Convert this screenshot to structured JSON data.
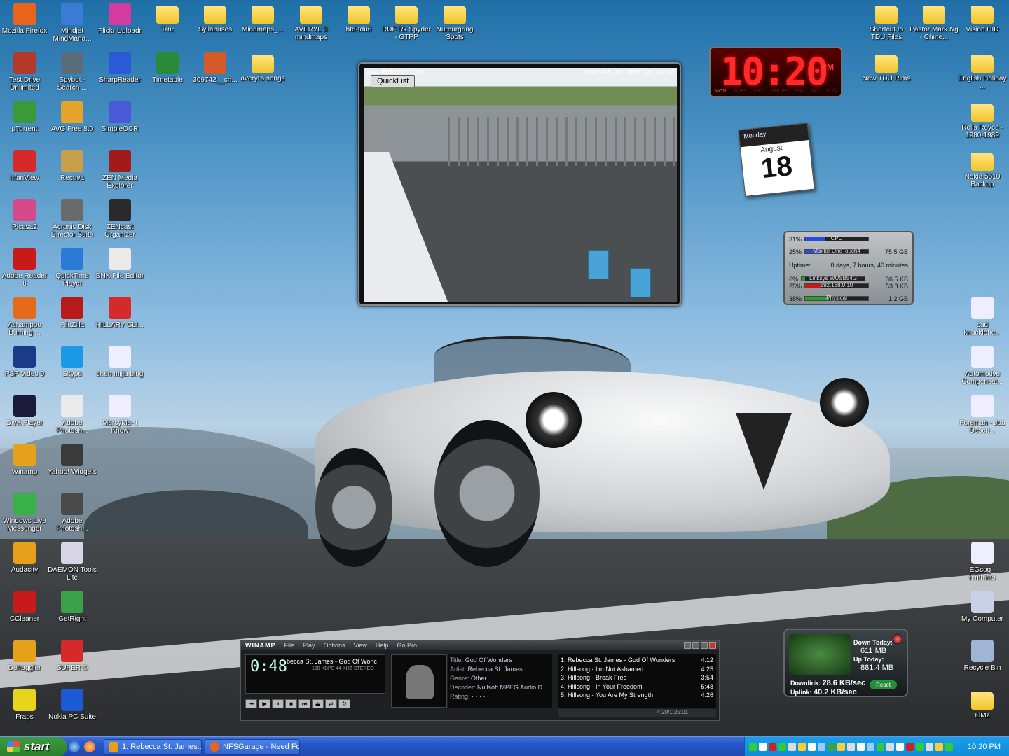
{
  "desktop": {
    "icons": [
      {
        "id": "firefox",
        "label": "Mozilla Firefox",
        "kind": "app",
        "color": "#e8641b"
      },
      {
        "id": "mindjet",
        "label": "Mindjet MindMana...",
        "kind": "app",
        "color": "#3a7bd5"
      },
      {
        "id": "flickr",
        "label": "Flickr Uploadr",
        "kind": "app",
        "color": "#d43aa0"
      },
      {
        "id": "trnr",
        "label": "Trnr",
        "kind": "folder"
      },
      {
        "id": "syllabuses",
        "label": "Syllabuses",
        "kind": "folder"
      },
      {
        "id": "mindmaps",
        "label": "Mindmaps_...",
        "kind": "folder"
      },
      {
        "id": "averyl-mindmaps",
        "label": "AVERYL'S mindmaps",
        "kind": "folder"
      },
      {
        "id": "htd-tdu6",
        "label": "htd-tdu6",
        "kind": "folder"
      },
      {
        "id": "ruf",
        "label": "RUF Rk Spyder - GTPP",
        "kind": "folder"
      },
      {
        "id": "nurburgring",
        "label": "Nurburgring Spots",
        "kind": "folder"
      },
      {
        "id": "shortcut-tdu",
        "label": "Shortcut to TDU Files",
        "kind": "folder"
      },
      {
        "id": "pastor",
        "label": "Pastor Mark Ng - Chine...",
        "kind": "folder"
      },
      {
        "id": "vision-hid",
        "label": "Vision HID",
        "kind": "folder"
      },
      {
        "id": "test-drive",
        "label": "Test Drive Unlimited",
        "kind": "app",
        "color": "#b33a2a"
      },
      {
        "id": "spybot",
        "label": "Spybot - Search ...",
        "kind": "app",
        "color": "#5a6b7a"
      },
      {
        "id": "sharpreader",
        "label": "SharpReader",
        "kind": "app",
        "color": "#2a5bd6"
      },
      {
        "id": "timetable",
        "label": "Timetable",
        "kind": "app",
        "color": "#2a8a3a"
      },
      {
        "id": "309742",
        "label": "309742__ch...",
        "kind": "app",
        "color": "#d45a2a"
      },
      {
        "id": "averyl-songs",
        "label": "averyl's songs",
        "kind": "folder"
      },
      {
        "id": "new-tdu-rims",
        "label": "New TDU Rims",
        "kind": "folder"
      },
      {
        "id": "english-holiday",
        "label": "English Holiday ...",
        "kind": "folder"
      },
      {
        "id": "utorrent",
        "label": "µTorrent",
        "kind": "app",
        "color": "#3a9a3a"
      },
      {
        "id": "avg",
        "label": "AVG Free 8.0",
        "kind": "app",
        "color": "#e6a52a"
      },
      {
        "id": "simpleocr",
        "label": "SimpleOCR",
        "kind": "app",
        "color": "#4a5ad6"
      },
      {
        "id": "rolls-royce",
        "label": "Rolls Royce - 1980-1989",
        "kind": "folder"
      },
      {
        "id": "irfanview",
        "label": "IrfanView",
        "kind": "app",
        "color": "#d62a2a"
      },
      {
        "id": "recuva",
        "label": "Recuva",
        "kind": "app",
        "color": "#c8a04a"
      },
      {
        "id": "zen-media",
        "label": "ZEN Media Explorer",
        "kind": "app",
        "color": "#a01a1a"
      },
      {
        "id": "nokia-backup",
        "label": "Nokia 5610 Backup",
        "kind": "folder"
      },
      {
        "id": "picasa",
        "label": "Picasa2",
        "kind": "app",
        "color": "#d64a8a"
      },
      {
        "id": "acronis",
        "label": "Acronis Disk Director Suite",
        "kind": "app",
        "color": "#6a6a6a"
      },
      {
        "id": "zencast",
        "label": "ZENcast Organizer",
        "kind": "app",
        "color": "#2a2a2a"
      },
      {
        "id": "adobe-reader",
        "label": "Adobe Reader 8",
        "kind": "app",
        "color": "#c81a1a"
      },
      {
        "id": "quicktime",
        "label": "QuickTime Player",
        "kind": "app",
        "color": "#2a7ad6"
      },
      {
        "id": "bnk-editor",
        "label": "BNK File Editor",
        "kind": "app",
        "color": "#eaeaea"
      },
      {
        "id": "ashampoo",
        "label": "Ashampoo Burning ...",
        "kind": "app",
        "color": "#e66a1a"
      },
      {
        "id": "filezilla",
        "label": "FileZilla",
        "kind": "app",
        "color": "#b81a1a"
      },
      {
        "id": "hillary",
        "label": "HILLARY CLI...",
        "kind": "app",
        "color": "#d62a2a"
      },
      {
        "id": "sad-knucklehe",
        "label": "sad knucklehe...",
        "kind": "app",
        "color": "#eef"
      },
      {
        "id": "psp-video",
        "label": "PSP Video 9",
        "kind": "app",
        "color": "#1a3a8a"
      },
      {
        "id": "skype",
        "label": "Skype",
        "kind": "app",
        "color": "#1a9ae6"
      },
      {
        "id": "shen-mijia",
        "label": "shen mijia bing",
        "kind": "app",
        "color": "#eef"
      },
      {
        "id": "automotive",
        "label": "Automotive Compensat...",
        "kind": "app",
        "color": "#eef"
      },
      {
        "id": "divx",
        "label": "DivX Player",
        "kind": "app",
        "color": "#1a1a3a"
      },
      {
        "id": "photoshop",
        "label": "Adobe Photosh...",
        "kind": "app",
        "color": "#eaeaea"
      },
      {
        "id": "mercyme",
        "label": "MercyMe- I Know",
        "kind": "app",
        "color": "#eef"
      },
      {
        "id": "foreman",
        "label": "Foreman - Job Descri...",
        "kind": "app",
        "color": "#eef"
      },
      {
        "id": "winamp",
        "label": "Winamp",
        "kind": "app",
        "color": "#e6a01a"
      },
      {
        "id": "yahoo-widgets",
        "label": "Yahoo! Widgets",
        "kind": "app",
        "color": "#3a3a3a"
      },
      {
        "id": "wlm",
        "label": "Windows Live Messenger",
        "kind": "app",
        "color": "#3ab04a"
      },
      {
        "id": "lightroom",
        "label": "Adobe Photosh...",
        "kind": "app",
        "color": "#4a4a4a"
      },
      {
        "id": "audacity",
        "label": "Audacity",
        "kind": "app",
        "color": "#e6a01a"
      },
      {
        "id": "daemon",
        "label": "DAEMON Tools Lite",
        "kind": "app",
        "color": "#d6d6e6"
      },
      {
        "id": "egcog",
        "label": "EGcog - hinthints",
        "kind": "app",
        "color": "#eef"
      },
      {
        "id": "ccleaner",
        "label": "CCleaner",
        "kind": "app",
        "color": "#c81a1a"
      },
      {
        "id": "getright",
        "label": "GetRight",
        "kind": "app",
        "color": "#3aa04a"
      },
      {
        "id": "my-computer",
        "label": "My Computer",
        "kind": "app",
        "color": "#c8d2e6"
      },
      {
        "id": "defraggler",
        "label": "Defraggler",
        "kind": "app",
        "color": "#e6a01a"
      },
      {
        "id": "super",
        "label": "SUPER ©",
        "kind": "app",
        "color": "#d62a2a"
      },
      {
        "id": "recycle-bin",
        "label": "Recycle Bin",
        "kind": "app",
        "color": "#a0b4d6"
      },
      {
        "id": "fraps",
        "label": "Fraps",
        "kind": "app",
        "color": "#e6d61a"
      },
      {
        "id": "nokia-pc-suite",
        "label": "Nokia PC Suite",
        "kind": "app",
        "color": "#1a5ad6"
      },
      {
        "id": "limz",
        "label": "LiMz",
        "kind": "folder"
      }
    ]
  },
  "webcam": {
    "button": "QuickList",
    "url": "www.ROBOTIX.COM",
    "stamp": "2006-06-16 CEST 16:14:02"
  },
  "clock_widget": {
    "time": "10:20",
    "ampm": "PM",
    "days": [
      "MON",
      "TUES",
      "WED",
      "THURS",
      "FRI",
      "SAT",
      "SUN"
    ]
  },
  "calendar_widget": {
    "weekday": "Monday",
    "month": "August",
    "day": "18"
  },
  "meter_widget": {
    "cpu": {
      "pct": "31%",
      "label": "CPU",
      "fill": 0.31
    },
    "disk": {
      "pct": "25%",
      "label": "Maxtor OneTouch4",
      "size": "75.5 GB",
      "fill": 0.25
    },
    "uptime_label": "Uptime:",
    "uptime": "0 days, 7 hours, 40 minutes",
    "net_down": {
      "pct": "6%",
      "label": "Linksys WUSB54G",
      "value": "36.5 KB",
      "fill": 0.06
    },
    "net_up": {
      "pct": "25%",
      "label": "192.168.0.10",
      "value": "53.8 KB",
      "fill": 0.25
    },
    "mem": {
      "pct": "38%",
      "label": "Physical",
      "value": "1.2 GB",
      "fill": 0.38
    },
    "colors": {
      "blue": "#2a4cd6",
      "red": "#c81a1a",
      "green": "#2aa02a"
    }
  },
  "net_widget": {
    "down_today_label": "Down Today:",
    "down_today": "611 MB",
    "up_today_label": "Up Today:",
    "up_today": "881.4 MB",
    "downlink_label": "Downlink:",
    "downlink": "28.6 KB/sec",
    "uplink_label": "Uplink:",
    "uplink": "40.2 KB/sec",
    "reset": "Reset"
  },
  "winamp": {
    "title": "WINAMP",
    "menu": [
      "File",
      "Play",
      "Options",
      "View",
      "Help",
      "Go Pro"
    ],
    "time": "0:48",
    "song": "becca St. James - God Of Wonc",
    "kbps": "128 KBPS  44 KHZ  STEREO",
    "info": {
      "title_label": "Title:",
      "title": "God Of Wonders",
      "artist_label": "Artist:",
      "artist": "Rebecca St. James",
      "genre_label": "Genre:",
      "genre": "Other",
      "decoder_label": "Decoder:",
      "decoder": "Nullsoft MPEG Audio D",
      "rating_label": "Rating:",
      "rating": "· · · · ·"
    },
    "playlist": [
      {
        "name": "1. Rebecca St. James - God Of Wonders",
        "len": "4:12"
      },
      {
        "name": "2. Hillsong - I'm Not Ashamed",
        "len": "4:25"
      },
      {
        "name": "3. Hillsong - Break Free",
        "len": "3:54"
      },
      {
        "name": "4. Hillsong - In Your Freedom",
        "len": "5:48"
      },
      {
        "name": "5. Hillsong - You Are My Strength",
        "len": "4:26"
      }
    ],
    "pl_total": "4:20/1:25:01"
  },
  "taskbar": {
    "start": "start",
    "tasks": [
      "1. Rebecca St. James...",
      "NFSGarage - Need Fo..."
    ],
    "clock": "10:20 PM",
    "colors": {
      "start_green": "#2b7f2b",
      "bar_blue": "#2457c7",
      "tray_blue": "#0f8ad6"
    }
  }
}
